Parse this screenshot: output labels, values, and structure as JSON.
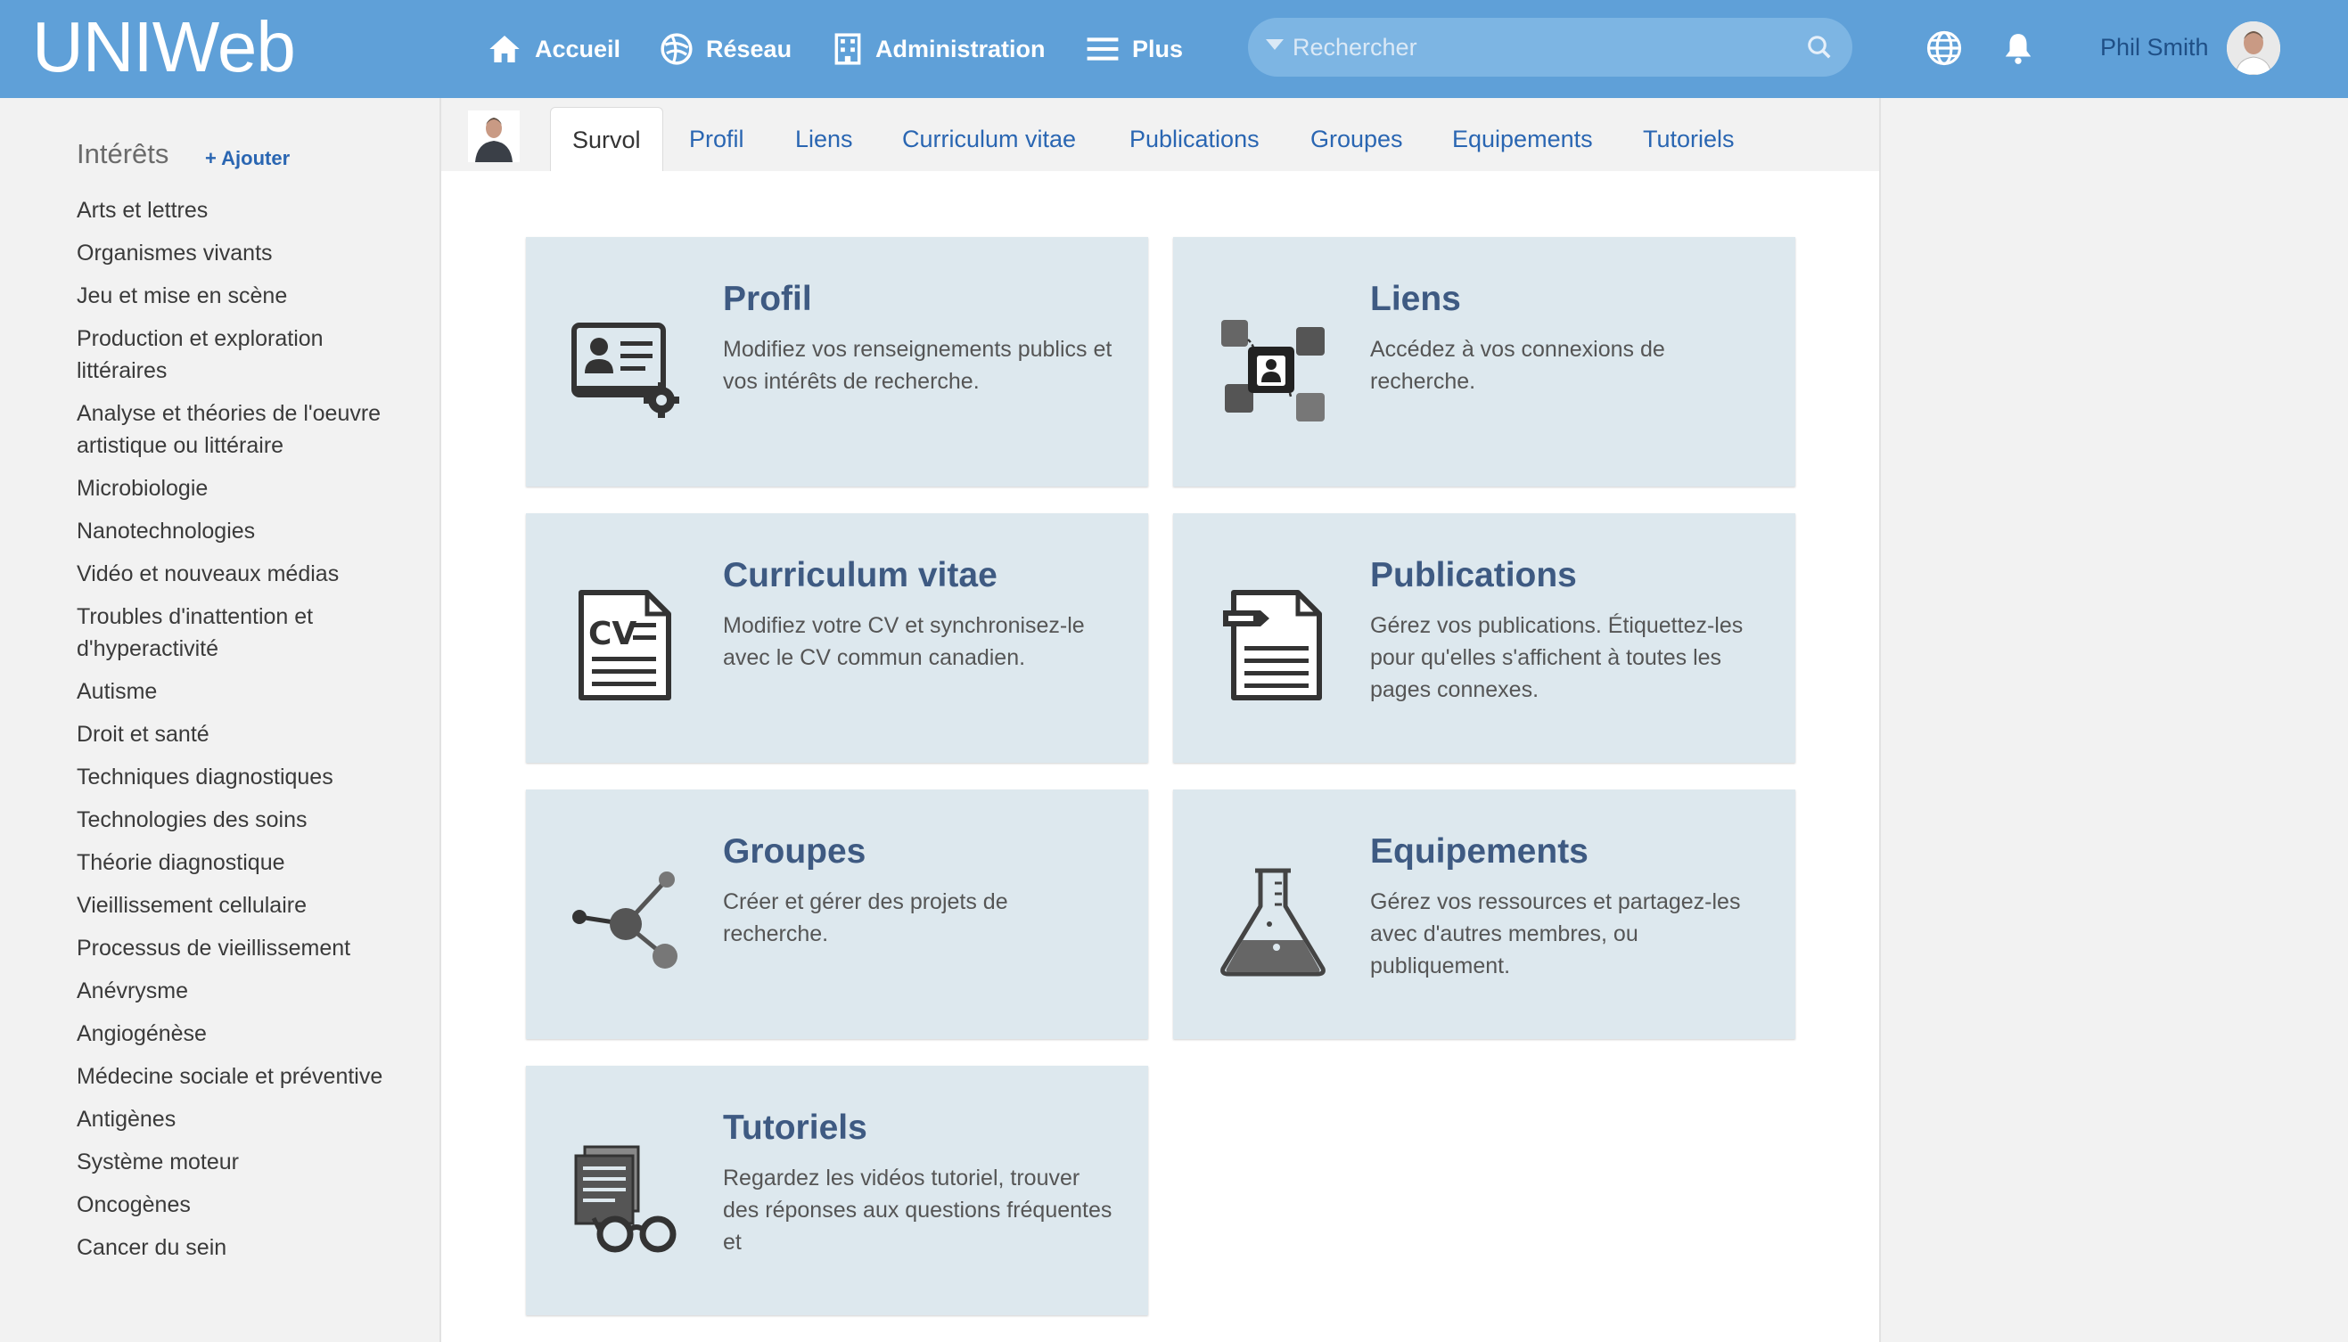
{
  "app": {
    "logo": "UNIWeb"
  },
  "topnav": {
    "items": [
      {
        "label": "Accueil",
        "icon": "home-icon"
      },
      {
        "label": "Réseau",
        "icon": "network-icon"
      },
      {
        "label": "Administration",
        "icon": "building-icon"
      },
      {
        "label": "Plus",
        "icon": "menu-icon"
      }
    ],
    "search_placeholder": "Rechercher",
    "user_name": "Phil Smith"
  },
  "sidebar": {
    "title": "Intérêts",
    "add_label": "+ Ajouter",
    "items": [
      "Arts et lettres",
      "Organismes vivants",
      "Jeu et mise en scène",
      "Production et exploration littéraires",
      "Analyse et théories de l'oeuvre artistique ou littéraire",
      "Microbiologie",
      "Nanotechnologies",
      "Vidéo et nouveaux médias",
      "Troubles d'inattention et d'hyperactivité",
      "Autisme",
      "Droit et santé",
      "Techniques diagnostiques",
      "Technologies des soins",
      "Théorie diagnostique",
      "Vieillissement cellulaire",
      "Processus de vieillissement",
      "Anévrysme",
      "Angiogénèse",
      "Médecine sociale et préventive",
      "Antigènes",
      "Système moteur",
      "Oncogènes",
      "Cancer du sein"
    ]
  },
  "tabs": [
    "Survol",
    "Profil",
    "Liens",
    "Curriculum vitae",
    "Publications",
    "Groupes",
    "Equipements",
    "Tutoriels"
  ],
  "active_tab": "Survol",
  "cards": [
    {
      "title": "Profil",
      "desc": "Modifiez vos renseignements publics et vos intérêts de recherche.",
      "icon": "id-card-gear-icon"
    },
    {
      "title": "Liens",
      "desc": "Accédez à vos connexions de recherche.",
      "icon": "connections-icon"
    },
    {
      "title": "Curriculum vitae",
      "desc": "Modifiez votre CV et synchronisez-le avec le CV commun canadien.",
      "icon": "cv-document-icon"
    },
    {
      "title": "Publications",
      "desc": "Gérez vos publications. Étiquettez-les pour qu'elles s'affichent à toutes les pages connexes.",
      "icon": "tagged-document-icon"
    },
    {
      "title": "Groupes",
      "desc": "Créer et gérer des projets de recherche.",
      "icon": "molecule-icon"
    },
    {
      "title": "Equipements",
      "desc": "Gérez vos ressources et partagez-les avec d'autres membres, ou publiquement.",
      "icon": "flask-icon"
    },
    {
      "title": "Tutoriels",
      "desc": "Regardez les vidéos tutoriel, trouver des réponses aux questions fréquentes et",
      "icon": "documents-glasses-icon"
    }
  ],
  "colors": {
    "topbar": "#5fa0d8",
    "card": "#dde8ee",
    "link": "#2a66b2",
    "card_title": "#3e5a82"
  }
}
